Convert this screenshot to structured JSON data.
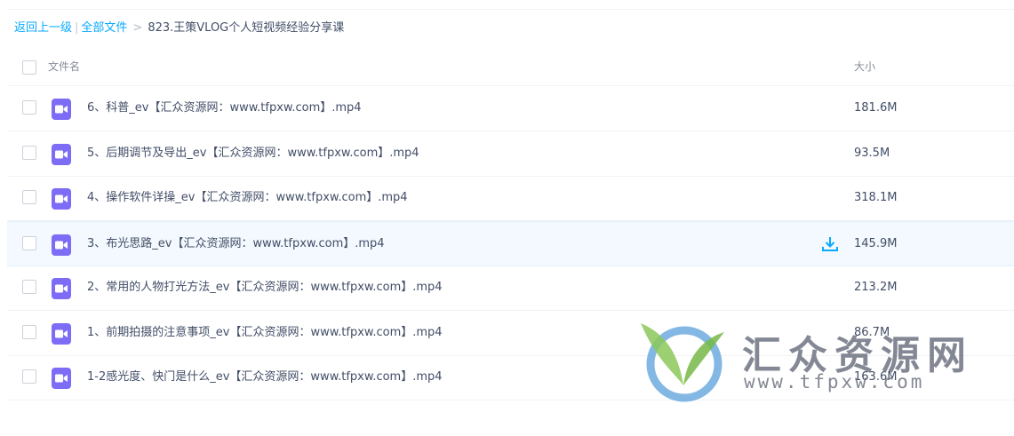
{
  "breadcrumb": {
    "back": "返回上一级",
    "separator": "|",
    "all_files": "全部文件",
    "arrow": ">",
    "current": "823.王策VLOG个人短视频经验分享课"
  },
  "table": {
    "header_name": "文件名",
    "header_size": "大小",
    "rows": [
      {
        "name": "6、科普_ev【汇众资源网：www.tfpxw.com】.mp4",
        "size": "181.6M",
        "icon": "video-file-icon"
      },
      {
        "name": "5、后期调节及导出_ev【汇众资源网：www.tfpxw.com】.mp4",
        "size": "93.5M",
        "icon": "video-file-icon"
      },
      {
        "name": "4、操作软件详操_ev【汇众资源网：www.tfpxw.com】.mp4",
        "size": "318.1M",
        "icon": "video-file-icon"
      },
      {
        "name": "3、布光思路_ev【汇众资源网：www.tfpxw.com】.mp4",
        "size": "145.9M",
        "icon": "video-file-icon",
        "hovered": true
      },
      {
        "name": "2、常用的人物打光方法_ev【汇众资源网：www.tfpxw.com】.mp4",
        "size": "213.2M",
        "icon": "video-file-icon"
      },
      {
        "name": "1、前期拍摄的注意事项_ev【汇众资源网：www.tfpxw.com】.mp4",
        "size": "86.7M",
        "icon": "video-file-icon"
      },
      {
        "name": "1-2感光度、快门是什么_ev【汇众资源网：www.tfpxw.com】.mp4",
        "size": "163.6M",
        "icon": "video-file-icon"
      }
    ]
  },
  "watermark": {
    "title": "汇众资源网",
    "url": "www.tfpxw.com"
  },
  "colors": {
    "link": "#09aaff",
    "text": "#424e67",
    "muted": "#878c9c",
    "video_icon": "#7d6cf5",
    "hover_row": "#f3f9fe",
    "download": "#09aaff"
  }
}
